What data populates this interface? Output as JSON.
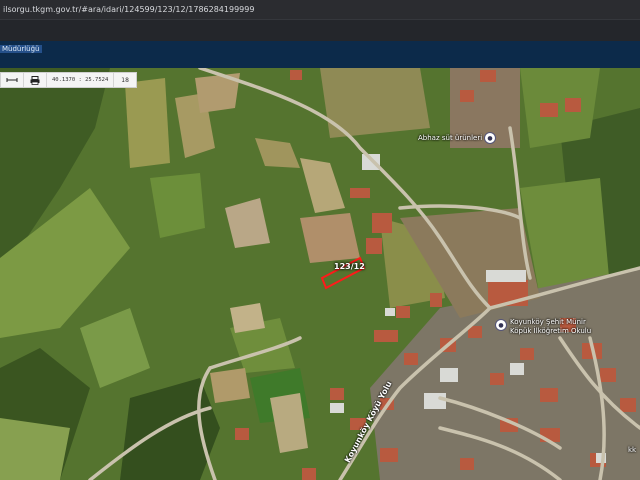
{
  "browser": {
    "url": "ilsorgu.tkgm.gov.tr/#ara/idari/124599/123/12/1786284199999"
  },
  "header": {
    "title": "Müdürlüğü"
  },
  "toolbar": {
    "measure_icon": "ruler-icon",
    "print_icon": "print-icon",
    "coordinates": "40.1370 : 25.7524",
    "zoom": "18"
  },
  "map": {
    "parcel_label": "123/12",
    "poi_1": "Abhaz süt ürünleri",
    "poi_2_line1": "Koyunköy Şehit Münir",
    "poi_2_line2": "Köpük İlköğretim Okulu",
    "road_label": "Koyunköy Köyü Yolu",
    "highlight_color": "#ff1a1a",
    "watermark": "kk"
  }
}
